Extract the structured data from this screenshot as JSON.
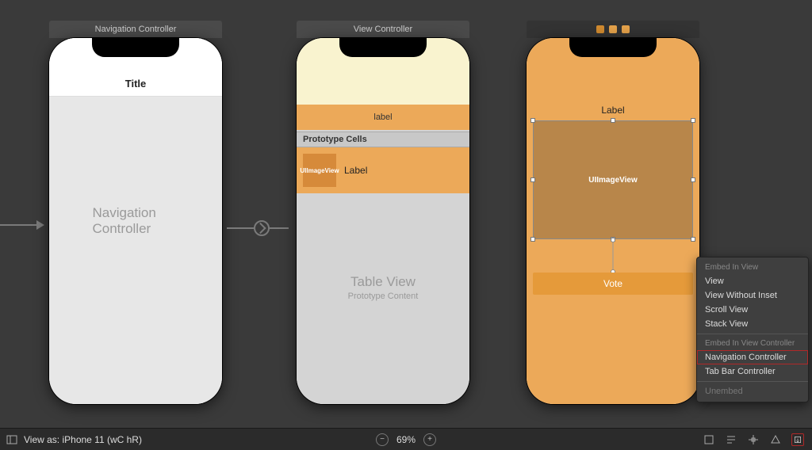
{
  "scenes": {
    "nav": {
      "title_bar": "Navigation Controller",
      "nav_title": "Title",
      "center_label": "Navigation Controller"
    },
    "list": {
      "title_bar": "View Controller",
      "header_label": "label",
      "prototype_header": "Prototype Cells",
      "cell_image": "UIImageView",
      "cell_label": "Label",
      "tv_title": "Table View",
      "tv_sub": "Prototype Content"
    },
    "detail": {
      "label": "Label",
      "imageview": "UIImageView",
      "vote_button": "Vote"
    }
  },
  "popup": {
    "section1_header": "Embed In View",
    "section1_items": [
      "View",
      "View Without Inset",
      "Scroll View",
      "Stack View"
    ],
    "section2_header": "Embed In View Controller",
    "section2_items": [
      "Navigation Controller",
      "Tab Bar Controller"
    ],
    "unembed": "Unembed"
  },
  "bottombar": {
    "view_as": "View as: iPhone 11 (wC hR)",
    "zoom": "69%"
  }
}
